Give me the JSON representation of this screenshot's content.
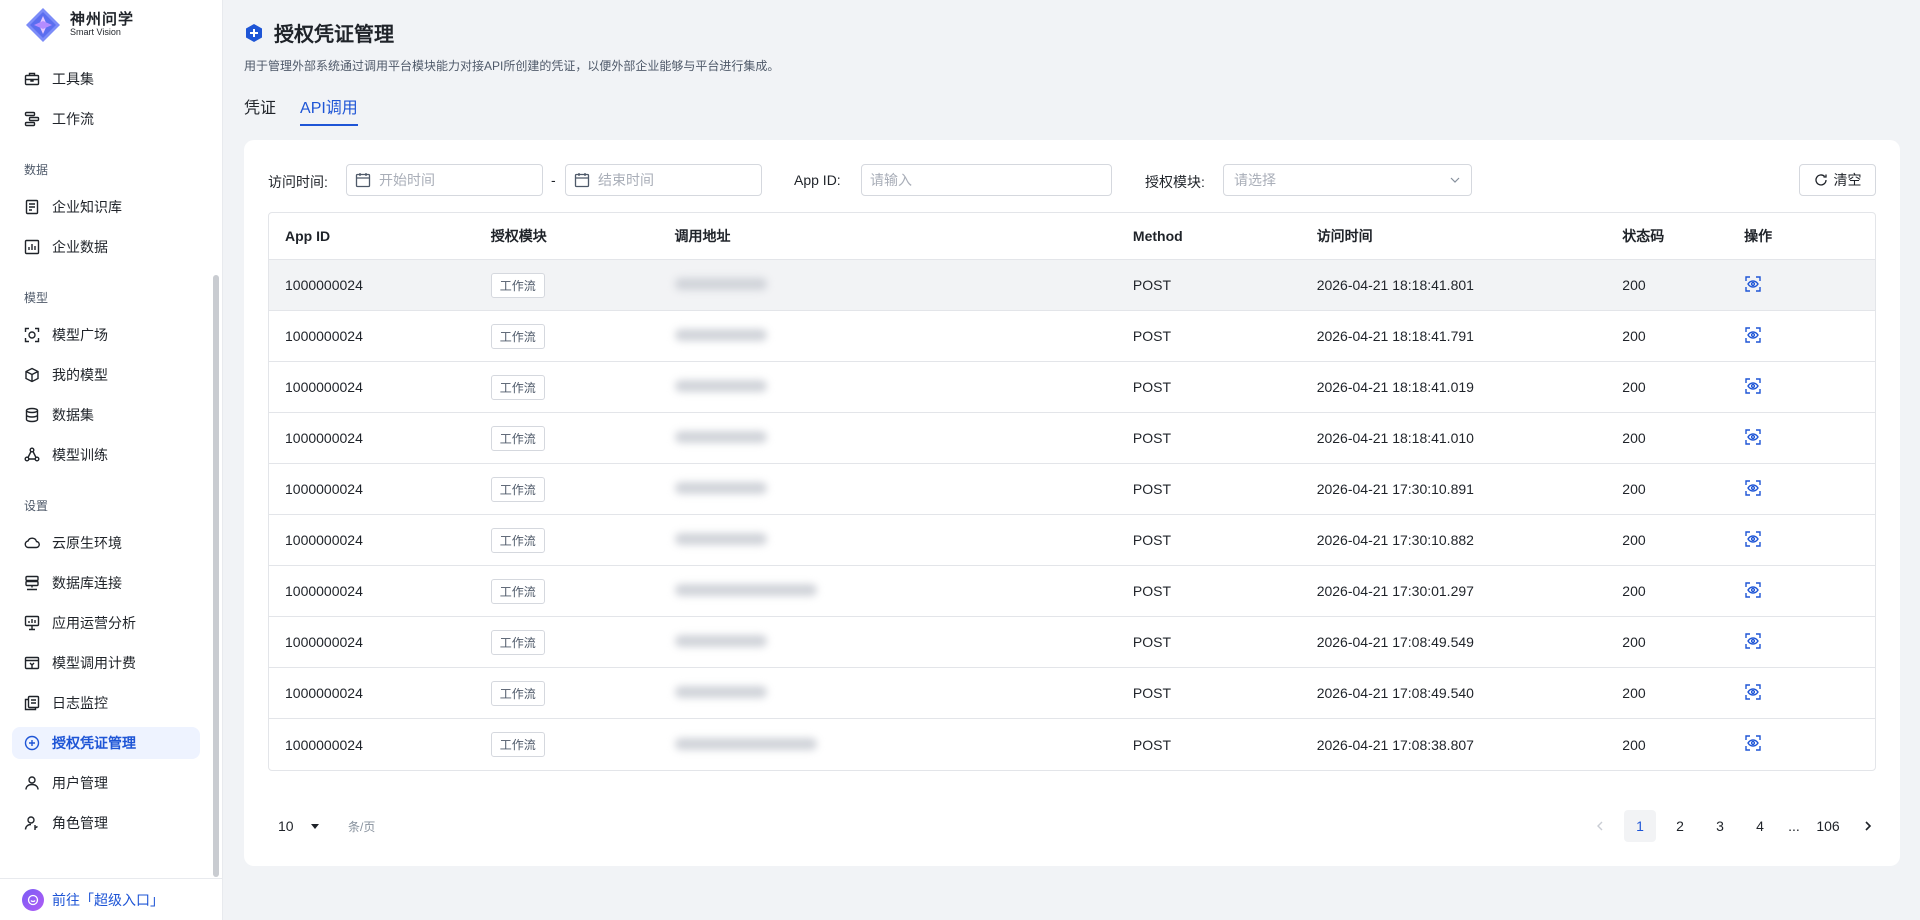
{
  "brand": {
    "name_cn": "神州问学",
    "name_en": "Smart Vision"
  },
  "sidebar": {
    "items": [
      {
        "label": "工具集",
        "icon": "toolbox-icon"
      },
      {
        "label": "工作流",
        "icon": "workflow-icon"
      },
      {
        "label": "企业知识库",
        "icon": "knowledge-base-icon"
      },
      {
        "label": "企业数据",
        "icon": "bar-chart-icon"
      },
      {
        "label": "模型广场",
        "icon": "model-square-icon"
      },
      {
        "label": "我的模型",
        "icon": "cube-icon"
      },
      {
        "label": "数据集",
        "icon": "database-icon"
      },
      {
        "label": "模型训练",
        "icon": "training-icon"
      },
      {
        "label": "云原生环境",
        "icon": "cloud-icon"
      },
      {
        "label": "数据库连接",
        "icon": "db-connect-icon"
      },
      {
        "label": "应用运营分析",
        "icon": "monitor-icon"
      },
      {
        "label": "模型调用计费",
        "icon": "billing-icon"
      },
      {
        "label": "日志监控",
        "icon": "log-icon"
      },
      {
        "label": "授权凭证管理",
        "icon": "credential-icon",
        "active": true
      },
      {
        "label": "用户管理",
        "icon": "user-icon"
      },
      {
        "label": "角色管理",
        "icon": "role-icon"
      }
    ],
    "groups": {
      "data": "数据",
      "model": "模型",
      "settings": "设置"
    },
    "footer_label": "前往「超级入口」"
  },
  "page": {
    "title": "授权凭证管理",
    "description": "用于管理外部系统通过调用平台模块能力对接API所创建的凭证，以便外部企业能够与平台进行集成。",
    "tabs": [
      {
        "label": "凭证"
      },
      {
        "label": "API调用",
        "active": true
      }
    ]
  },
  "filters": {
    "time_label": "访问时间:",
    "start_placeholder": "开始时间",
    "separator": "-",
    "end_placeholder": "结束时间",
    "appid_label": "App ID:",
    "appid_placeholder": "请输入",
    "module_label": "授权模块:",
    "module_placeholder": "请选择",
    "clear_label": "清空"
  },
  "table": {
    "columns": [
      "App ID",
      "授权模块",
      "调用地址",
      "Method",
      "访问时间",
      "状态码",
      "操作"
    ],
    "rows": [
      {
        "app_id": "1000000024",
        "module": "工作流",
        "method": "POST",
        "time": "2026-04-21 18:18:41.801",
        "status": "200"
      },
      {
        "app_id": "1000000024",
        "module": "工作流",
        "method": "POST",
        "time": "2026-04-21 18:18:41.791",
        "status": "200"
      },
      {
        "app_id": "1000000024",
        "module": "工作流",
        "method": "POST",
        "time": "2026-04-21 18:18:41.019",
        "status": "200"
      },
      {
        "app_id": "1000000024",
        "module": "工作流",
        "method": "POST",
        "time": "2026-04-21 18:18:41.010",
        "status": "200"
      },
      {
        "app_id": "1000000024",
        "module": "工作流",
        "method": "POST",
        "time": "2026-04-21 17:30:10.891",
        "status": "200"
      },
      {
        "app_id": "1000000024",
        "module": "工作流",
        "method": "POST",
        "time": "2026-04-21 17:30:10.882",
        "status": "200"
      },
      {
        "app_id": "1000000024",
        "module": "工作流",
        "method": "POST",
        "time": "2026-04-21 17:30:01.297",
        "status": "200"
      },
      {
        "app_id": "1000000024",
        "module": "工作流",
        "method": "POST",
        "time": "2026-04-21 17:08:49.549",
        "status": "200"
      },
      {
        "app_id": "1000000024",
        "module": "工作流",
        "method": "POST",
        "time": "2026-04-21 17:08:49.540",
        "status": "200"
      },
      {
        "app_id": "1000000024",
        "module": "工作流",
        "method": "POST",
        "time": "2026-04-21 17:08:38.807",
        "status": "200"
      }
    ]
  },
  "pagination": {
    "page_size": "10",
    "unit": "条/页",
    "pages": [
      "1",
      "2",
      "3",
      "4"
    ],
    "ellipsis": "...",
    "last_page": "106",
    "current": "1"
  },
  "colors": {
    "accent": "#1e55d6",
    "active_bg": "#eef3ff"
  }
}
